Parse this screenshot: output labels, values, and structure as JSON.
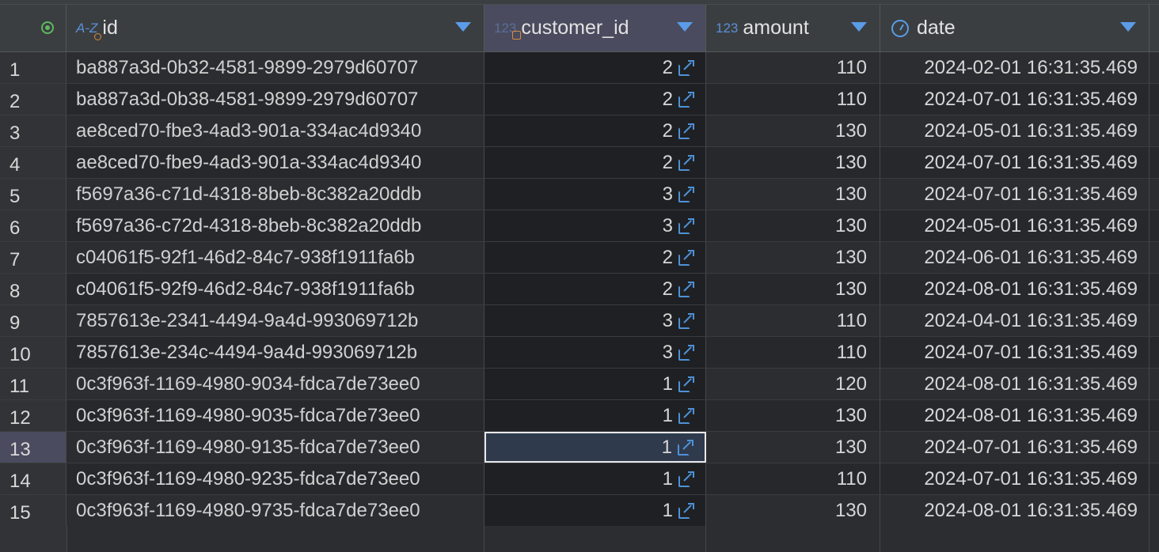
{
  "columns": [
    {
      "label": "id",
      "type_label": "A-Z"
    },
    {
      "label": "customer_id",
      "type_label": "123"
    },
    {
      "label": "amount",
      "type_label": "123"
    },
    {
      "label": "date",
      "type_label": ""
    }
  ],
  "rows": [
    {
      "n": "1",
      "id": "ba887a3d-0b32-4581-9899-2979d60707",
      "customer_id": "2",
      "amount": "110",
      "date": "2024-02-01 16:31:35.469"
    },
    {
      "n": "2",
      "id": "ba887a3d-0b38-4581-9899-2979d60707",
      "customer_id": "2",
      "amount": "110",
      "date": "2024-07-01 16:31:35.469"
    },
    {
      "n": "3",
      "id": "ae8ced70-fbe3-4ad3-901a-334ac4d9340",
      "customer_id": "2",
      "amount": "130",
      "date": "2024-05-01 16:31:35.469"
    },
    {
      "n": "4",
      "id": "ae8ced70-fbe9-4ad3-901a-334ac4d9340",
      "customer_id": "2",
      "amount": "130",
      "date": "2024-07-01 16:31:35.469"
    },
    {
      "n": "5",
      "id": "f5697a36-c71d-4318-8beb-8c382a20ddb",
      "customer_id": "3",
      "amount": "130",
      "date": "2024-07-01 16:31:35.469"
    },
    {
      "n": "6",
      "id": "f5697a36-c72d-4318-8beb-8c382a20ddb",
      "customer_id": "3",
      "amount": "130",
      "date": "2024-05-01 16:31:35.469"
    },
    {
      "n": "7",
      "id": "c04061f5-92f1-46d2-84c7-938f1911fa6b",
      "customer_id": "2",
      "amount": "130",
      "date": "2024-06-01 16:31:35.469"
    },
    {
      "n": "8",
      "id": "c04061f5-92f9-46d2-84c7-938f1911fa6b",
      "customer_id": "2",
      "amount": "130",
      "date": "2024-08-01 16:31:35.469"
    },
    {
      "n": "9",
      "id": "7857613e-2341-4494-9a4d-993069712b",
      "customer_id": "3",
      "amount": "110",
      "date": "2024-04-01 16:31:35.469"
    },
    {
      "n": "10",
      "id": "7857613e-234c-4494-9a4d-993069712b",
      "customer_id": "3",
      "amount": "110",
      "date": "2024-07-01 16:31:35.469"
    },
    {
      "n": "11",
      "id": "0c3f963f-1169-4980-9034-fdca7de73ee0",
      "customer_id": "1",
      "amount": "120",
      "date": "2024-08-01 16:31:35.469"
    },
    {
      "n": "12",
      "id": "0c3f963f-1169-4980-9035-fdca7de73ee0",
      "customer_id": "1",
      "amount": "130",
      "date": "2024-08-01 16:31:35.469"
    },
    {
      "n": "13",
      "id": "0c3f963f-1169-4980-9135-fdca7de73ee0",
      "customer_id": "1",
      "amount": "130",
      "date": "2024-07-01 16:31:35.469"
    },
    {
      "n": "14",
      "id": "0c3f963f-1169-4980-9235-fdca7de73ee0",
      "customer_id": "1",
      "amount": "110",
      "date": "2024-07-01 16:31:35.469"
    },
    {
      "n": "15",
      "id": "0c3f963f-1169-4980-9735-fdca7de73ee0",
      "customer_id": "1",
      "amount": "130",
      "date": "2024-08-01 16:31:35.469"
    }
  ],
  "selected_row": "13",
  "selected_column": "customer_id",
  "icons": {
    "row_header": "record-indicator-icon",
    "text_type": "text-type-icon",
    "number_type": "number-type-icon",
    "date_type": "clock-icon",
    "sort": "sort-dropdown-icon",
    "foreign_key_link": "open-link-icon"
  },
  "colors": {
    "accent": "#5a9ce8",
    "selection": "#4a4b5e",
    "background": "#2b2d30"
  }
}
